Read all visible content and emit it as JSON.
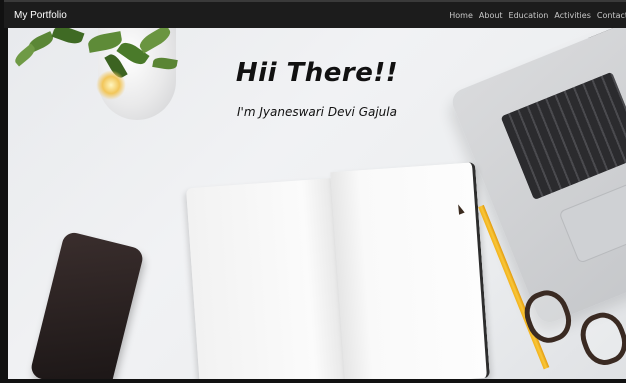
{
  "navbar": {
    "brand": "My Portfolio",
    "links": [
      "Home",
      "About",
      "Education",
      "Activities",
      "Contact"
    ]
  },
  "hero": {
    "title": "Hii There!!",
    "subtitle": "I'm Jyaneswari Devi Gajula"
  },
  "colors": {
    "navbar_bg": "#1c1c1c",
    "hero_bg": "#eceef0",
    "text": "#111111"
  }
}
